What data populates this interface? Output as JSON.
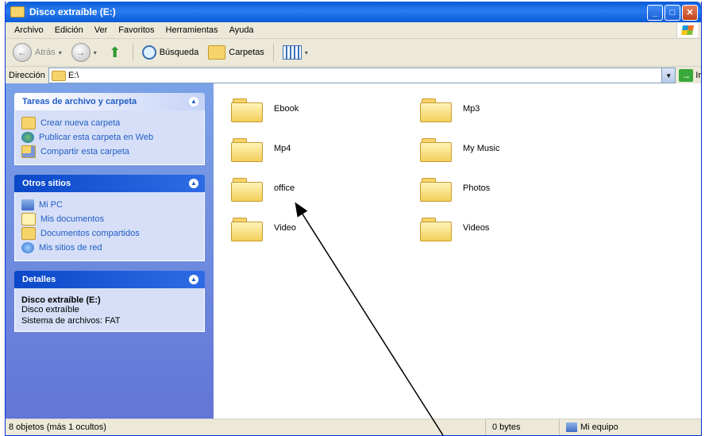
{
  "window": {
    "title": "Disco extraíble (E:)",
    "accent": "#0a5bd8"
  },
  "menu": [
    "Archivo",
    "Edición",
    "Ver",
    "Favoritos",
    "Herramientas",
    "Ayuda"
  ],
  "toolbar": {
    "back_label": "Atrás",
    "search_label": "Búsqueda",
    "folders_label": "Carpetas"
  },
  "address": {
    "label": "Dirección",
    "value": "E:\\",
    "go_label": "Ir"
  },
  "taskpane": {
    "file_tasks": {
      "title": "Tareas de archivo y carpeta",
      "items": [
        {
          "label": "Crear nueva carpeta",
          "icon": "new-folder-icon"
        },
        {
          "label": "Publicar esta carpeta en Web",
          "icon": "globe-icon"
        },
        {
          "label": "Compartir esta carpeta",
          "icon": "share-folder-icon"
        }
      ]
    },
    "other_places": {
      "title": "Otros sitios",
      "items": [
        {
          "label": "Mi PC",
          "icon": "computer-icon"
        },
        {
          "label": "Mis documentos",
          "icon": "documents-icon"
        },
        {
          "label": "Documentos compartidos",
          "icon": "shared-docs-icon"
        },
        {
          "label": "Mis sitios de red",
          "icon": "network-icon"
        }
      ]
    },
    "details": {
      "title": "Detalles",
      "name": "Disco extraíble (E:)",
      "type": "Disco extraíble",
      "filesystem": "Sistema de archivos: FAT"
    }
  },
  "folders": [
    {
      "name": "Ebook"
    },
    {
      "name": "Mp3"
    },
    {
      "name": "Mp4"
    },
    {
      "name": "My Music"
    },
    {
      "name": "office"
    },
    {
      "name": "Photos"
    },
    {
      "name": "Video"
    },
    {
      "name": "Videos"
    }
  ],
  "status": {
    "count": "8 objetos (más 1 ocultos)",
    "size": "0 bytes",
    "zone": "Mi equipo"
  }
}
